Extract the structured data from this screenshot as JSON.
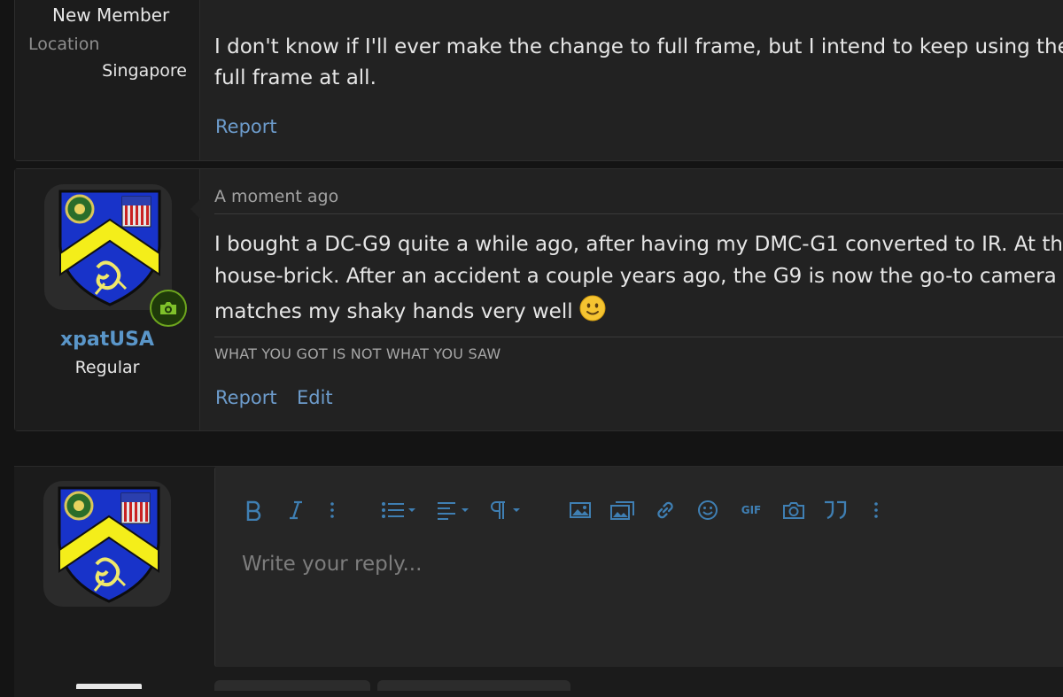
{
  "post1": {
    "user_role": "New Member",
    "location_label": "Location",
    "location_value": "Singapore",
    "text_line1": "I don't know if I'll ever make the change to full frame, but I intend to keep using the M",
    "text_line2": "full frame at all.",
    "report_label": "Report"
  },
  "post2": {
    "username": "xpatUSA",
    "user_title": "Regular",
    "badge_icon": "camera-icon",
    "timestamp": "A moment ago",
    "text_line1": "I bought a DC-G9 quite a while ago, after having my DMC-G1 converted to IR. At that",
    "text_line2": "house-brick. After an accident a couple years ago, the G9 is now the go-to camera ma",
    "text_line3": "matches my shaky hands very well",
    "smiley_icon": "slightly-smiling-face-icon",
    "signature": "WHAT YOU GOT IS NOT WHAT YOU SAW",
    "report_label": "Report",
    "edit_label": "Edit"
  },
  "reply": {
    "placeholder": "Write your reply...",
    "toolbar": [
      {
        "name": "bold",
        "icon": "bold-icon"
      },
      {
        "name": "italic",
        "icon": "italic-icon"
      },
      {
        "name": "more-text",
        "icon": "vertical-dots-icon"
      },
      {
        "name": "list",
        "icon": "list-dropdown-icon"
      },
      {
        "name": "align",
        "icon": "align-dropdown-icon"
      },
      {
        "name": "paragraph",
        "icon": "paragraph-dropdown-icon"
      },
      {
        "name": "image",
        "icon": "image-icon"
      },
      {
        "name": "media",
        "icon": "media-icon"
      },
      {
        "name": "link",
        "icon": "link-icon"
      },
      {
        "name": "smilies",
        "icon": "smile-icon"
      },
      {
        "name": "gif",
        "icon": "gif-icon",
        "label": "GIF"
      },
      {
        "name": "gallery",
        "icon": "camera-icon"
      },
      {
        "name": "quote",
        "icon": "quote-icon"
      },
      {
        "name": "more-insert",
        "icon": "vertical-dots-icon"
      }
    ]
  },
  "colors": {
    "background": "#141414",
    "post_bg": "#222222",
    "link_blue": "#6d9ccc",
    "username_blue": "#5a96c9",
    "toolbar_blue": "#3f7fb3",
    "badge_green": "#6ea61e"
  }
}
